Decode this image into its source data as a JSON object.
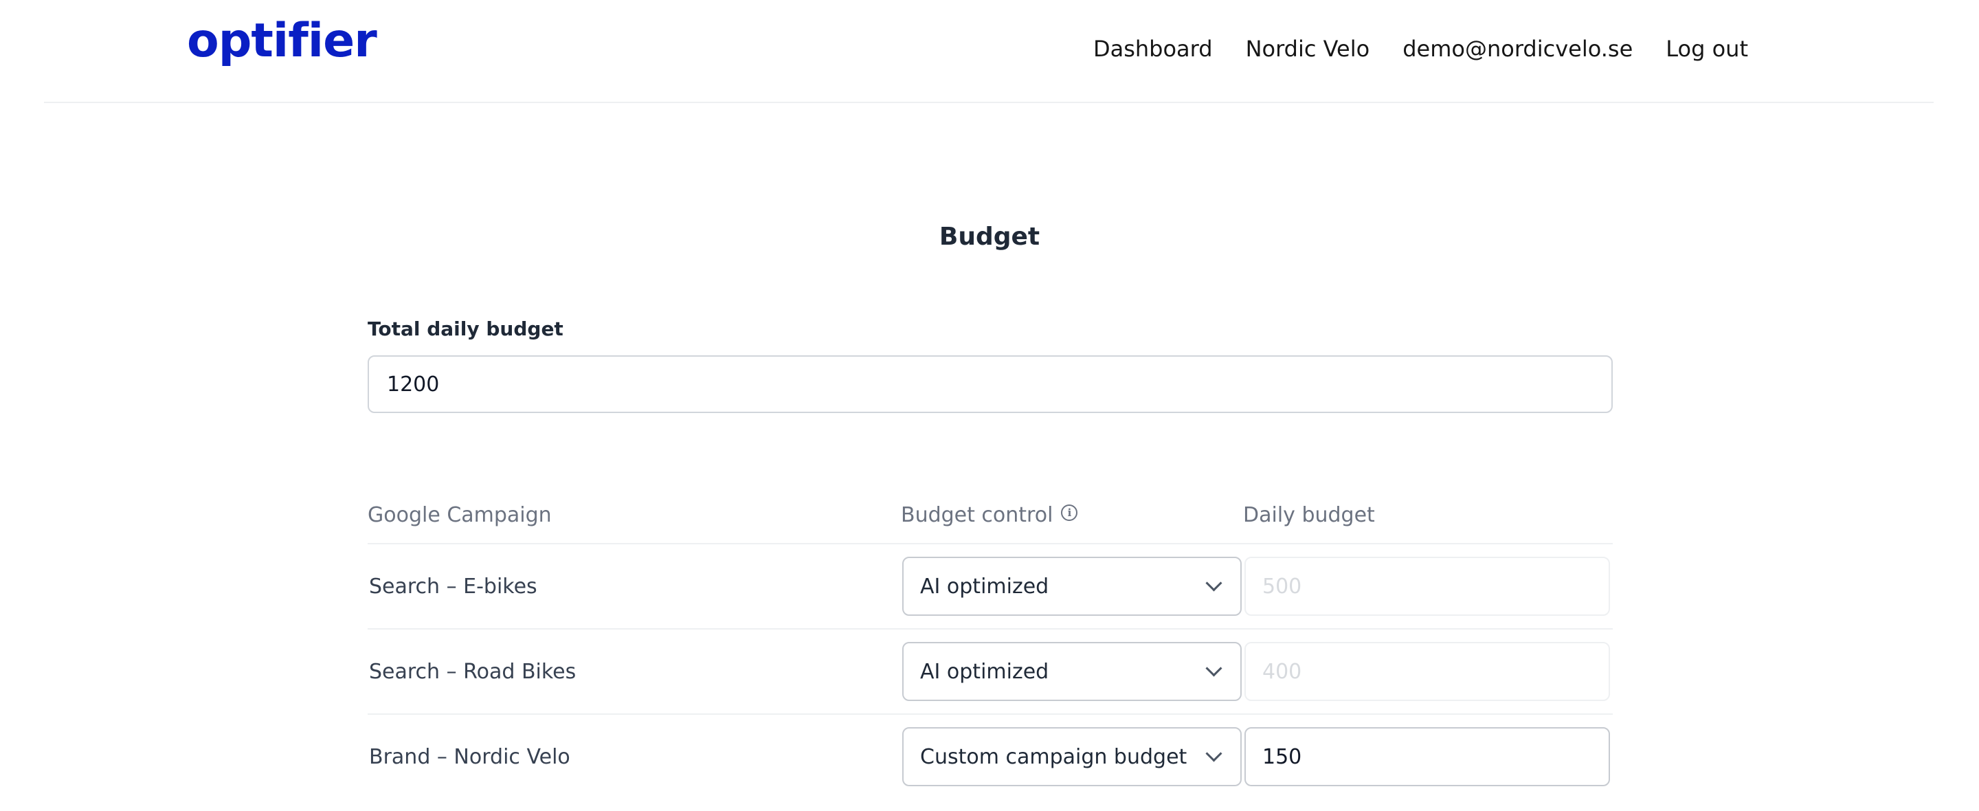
{
  "header": {
    "logo": "optifier",
    "brand_color": "#0a1fc4",
    "nav": [
      "Dashboard",
      "Nordic Velo",
      "demo@nordicvelo.se",
      "Log out"
    ]
  },
  "page": {
    "title": "Budget"
  },
  "total_budget": {
    "label": "Total daily budget",
    "value": "1200"
  },
  "table": {
    "headers": {
      "campaign": "Google Campaign",
      "control": "Budget control",
      "control_info_icon": "info-icon",
      "daily": "Daily budget"
    },
    "rows": [
      {
        "campaign": "Search – E-bikes",
        "control": "AI optimized",
        "budget": "500",
        "budget_editable": false
      },
      {
        "campaign": "Search – Road Bikes",
        "control": "AI optimized",
        "budget": "400",
        "budget_editable": false
      },
      {
        "campaign": "Brand – Nordic Velo",
        "control": "Custom campaign budget",
        "budget": "150",
        "budget_editable": true
      }
    ]
  }
}
